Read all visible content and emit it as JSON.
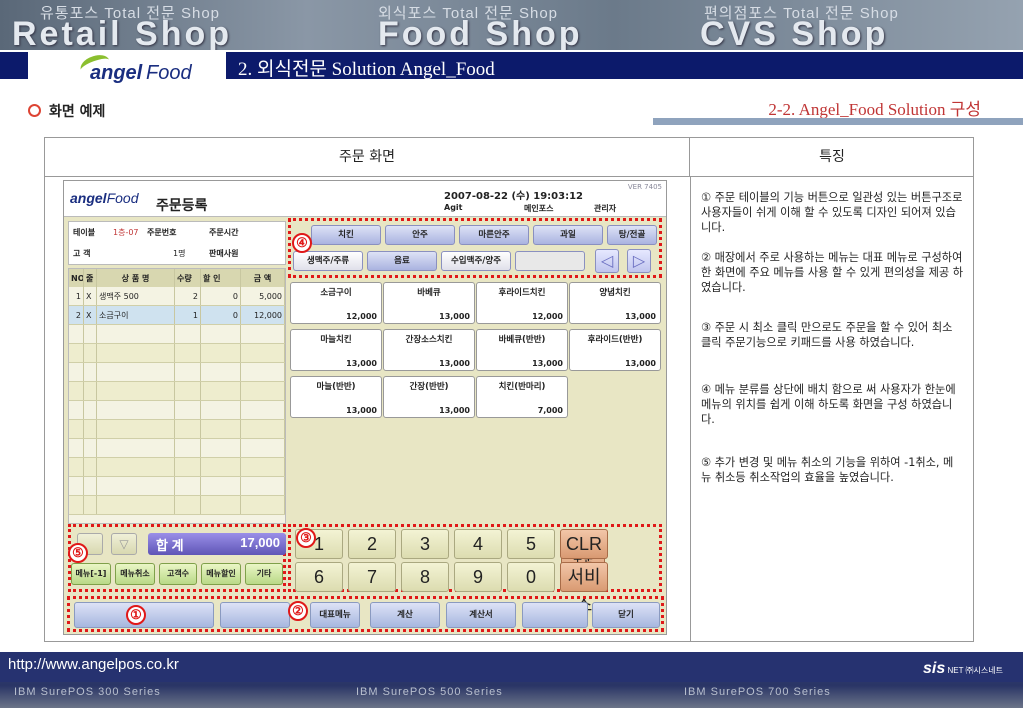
{
  "banner": {
    "sub1": "유통포스 Total 전문 Shop",
    "big1": "Retail Shop",
    "sub2": "외식포스 Total 전문 Shop",
    "big2": "Food Shop",
    "sub3": "편의점포스 Total 전문 Shop",
    "big3": "CVS Shop"
  },
  "brand": {
    "angel": "angel",
    "food": "Food"
  },
  "title": "2. 외식전문 Solution Angel_Food",
  "section_left": "화면 예제",
  "section_right": "2-2.  Angel_Food Solution 구성",
  "table": {
    "head_left": "주문 화면",
    "head_right": "특징"
  },
  "features": [
    "① 주문 테이블의 기능 버튼으로 일관성 있는 버튼구조로 사용자들이 쉬게 이해 할 수 있도록 디자인 되어져 있습니다.",
    "② 매장에서 주로 사용하는 메뉴는 대표 메뉴로 구성하여 한 화면에 주요 메뉴를 사용 할 수 있게 편의성을 제공 하였습니다.",
    "③ 주문 시 최소 클릭 만으로도 주문을 할 수 있어 최소 클릭 주문기능으로 키패드를 사용 하였습니다.",
    "④ 메뉴 분류를 상단에 배치 함으로 써 사용자가 한눈에 메뉴의 위치를 쉽게 이해 하도록 화면을 구성 하였습니다.",
    "⑤ 추가 변경 및 메뉴 취소의 기능을 위하여 -1취소, 메뉴 취소등 취소작업의 효율을 높였습니다."
  ],
  "pos": {
    "logo_angel": "angel",
    "logo_food": "Food",
    "title": "주문등록",
    "datetime": "2007-08-22 (수) 19:03:12",
    "ver": "VER 7405",
    "agit": "Agit",
    "main_pos": "메인포스",
    "manager": "관리자",
    "info": {
      "table_label": "테이블",
      "table_value": "1층-07",
      "order_no_label": "주문번호",
      "order_time_label": "주문시간",
      "guest_label": "고  객",
      "guest_value": "1명",
      "staff_label": "판매사원"
    },
    "order_head": [
      "NO",
      "줄",
      "상 품 명",
      "수량",
      "할 인",
      "금 액"
    ],
    "order_rows": [
      {
        "no": "1",
        "mark": "X",
        "name": "생맥주 500",
        "qty": "2",
        "disc": "0",
        "amt": "5,000"
      },
      {
        "no": "2",
        "mark": "X",
        "name": "소금구이",
        "qty": "1",
        "disc": "0",
        "amt": "12,000"
      }
    ],
    "categories": [
      {
        "label": "치킨",
        "on": false
      },
      {
        "label": "안주",
        "on": false
      },
      {
        "label": "마른안주",
        "on": false
      },
      {
        "label": "과일",
        "on": false
      },
      {
        "label": "탕/전골",
        "on": false
      },
      {
        "label": "생맥주/주류",
        "on": true
      },
      {
        "label": "음료",
        "on": false
      },
      {
        "label": "수입맥주/양주",
        "on": true
      }
    ],
    "menus": [
      {
        "name": "소금구이",
        "price": "12,000"
      },
      {
        "name": "바베큐",
        "price": "13,000"
      },
      {
        "name": "후라이드치킨",
        "price": "12,000"
      },
      {
        "name": "양념치킨",
        "price": "13,000"
      },
      {
        "name": "마늘치킨",
        "price": "13,000"
      },
      {
        "name": "간장소스치킨",
        "price": "13,000"
      },
      {
        "name": "바베큐(반반)",
        "price": "13,000"
      },
      {
        "name": "후라이드(반반)",
        "price": "13,000"
      },
      {
        "name": "마늘(반반)",
        "price": "13,000"
      },
      {
        "name": "간장(반반)",
        "price": "13,000"
      },
      {
        "name": "치킨(반마리)",
        "price": "7,000"
      }
    ],
    "keys_row1": [
      "1",
      "2",
      "3",
      "4",
      "5",
      "CLR"
    ],
    "keys_row2": [
      "6",
      "7",
      "8",
      "9",
      "0",
      "서비스"
    ],
    "order_key": "주 문",
    "total_label": "합 계",
    "total_value": "17,000",
    "func_buttons": [
      "메뉴[-1]",
      "메뉴취소",
      "고객수",
      "메뉴할인",
      "기타"
    ],
    "bottom_buttons": [
      "대표메뉴",
      "계산",
      "계산서",
      "닫기"
    ],
    "callouts": [
      "①",
      "②",
      "③",
      "④",
      "⑤"
    ]
  },
  "footer": {
    "url": "http://www.angelpos.co.kr",
    "sis": "sis",
    "sis_rest": "NET ㈜시스네트",
    "sub1": "IBM SurePOS 300 Series",
    "sub2": "IBM SurePOS 500 Series",
    "sub3": "IBM SurePOS 700 Series"
  },
  "colors": {
    "navy": "#0c1a6b",
    "callout_red": "#e01818",
    "section_red": "#c03535"
  }
}
